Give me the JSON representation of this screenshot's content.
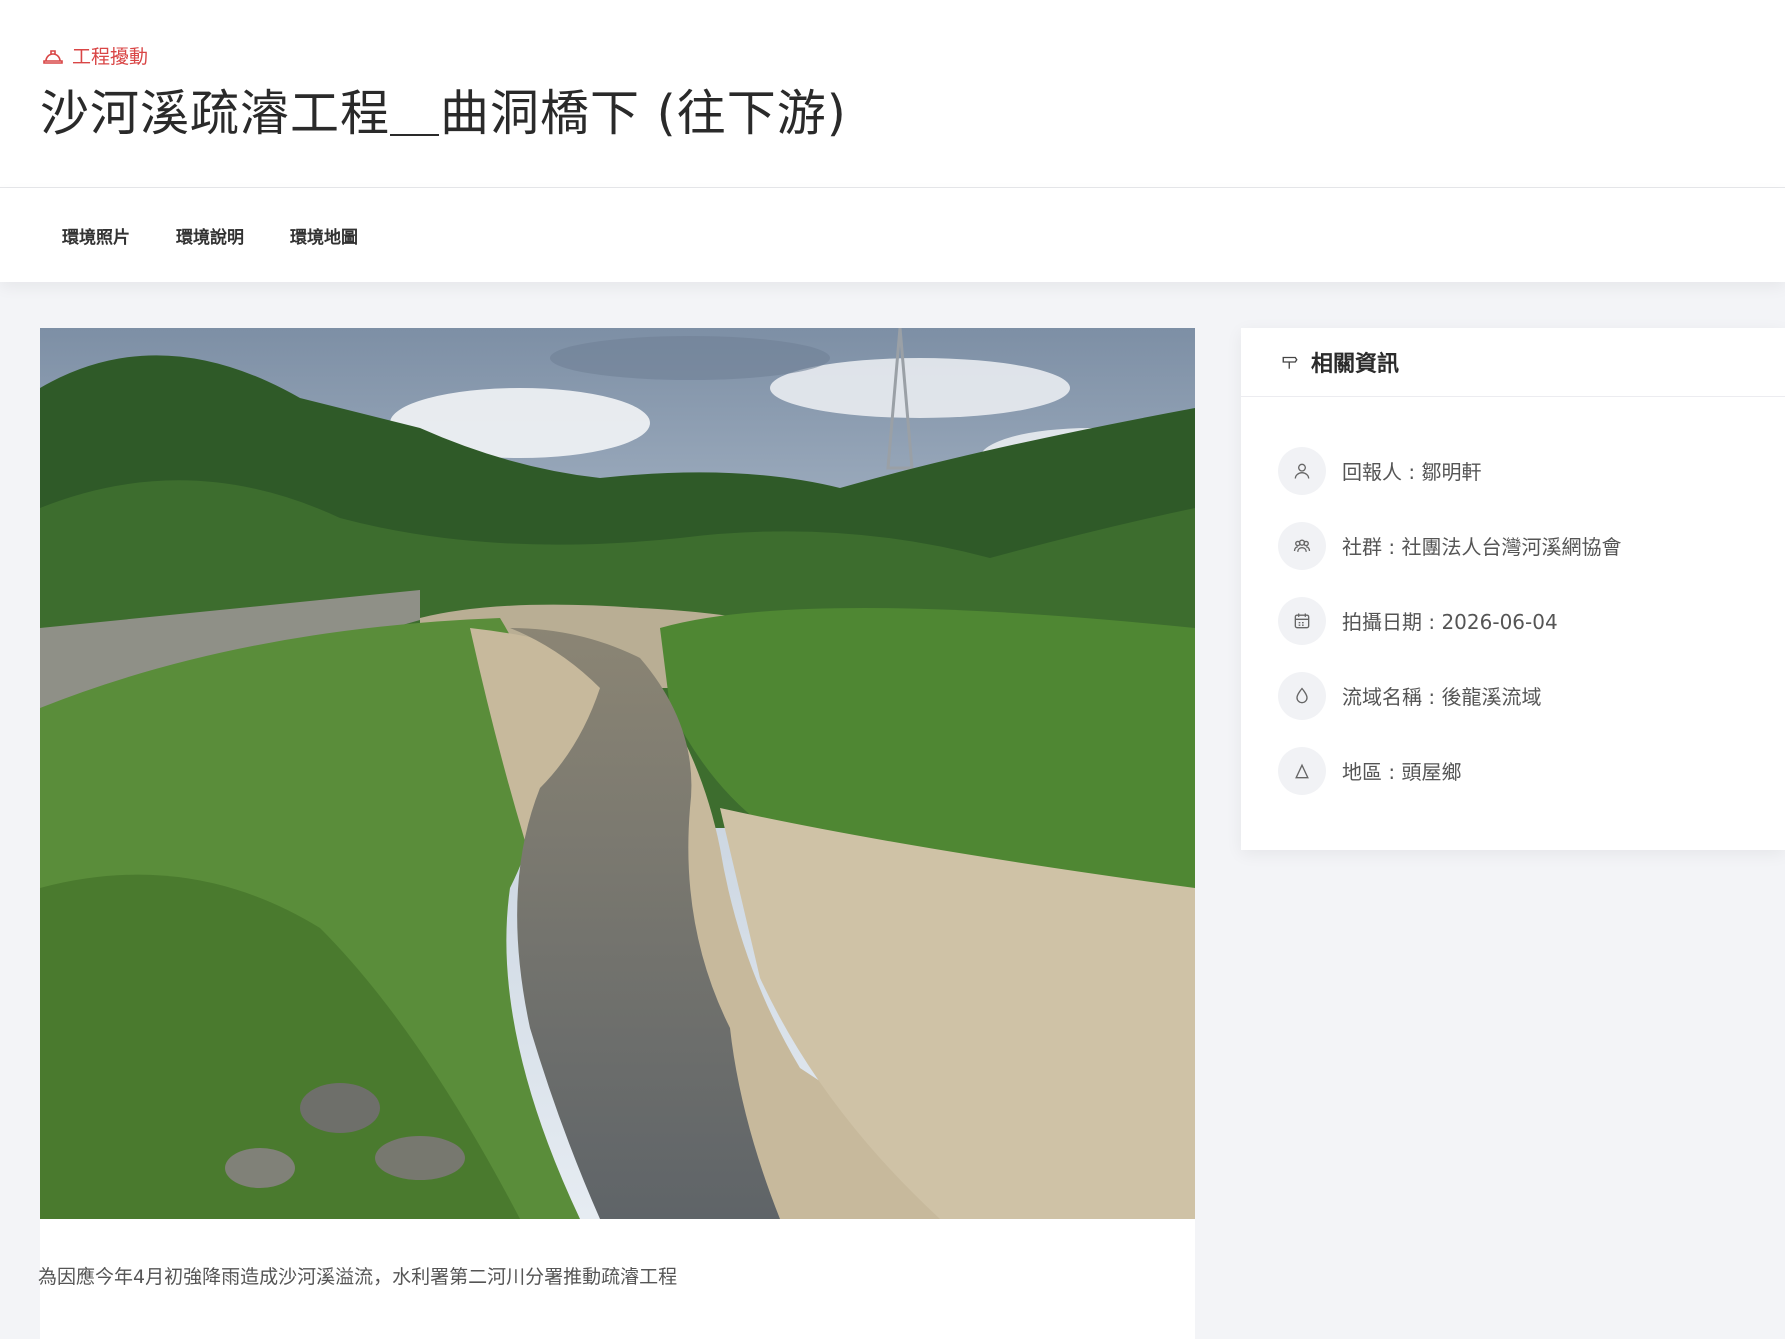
{
  "header": {
    "category": "工程擾動",
    "title": "沙河溪疏濬工程＿曲洞橋下 (往下游)"
  },
  "tabs": [
    {
      "label": "環境照片"
    },
    {
      "label": "環境說明"
    },
    {
      "label": "環境地圖"
    }
  ],
  "main": {
    "caption": "為因應今年4月初強降雨造成沙河溪溢流，水利署第二河川分署推動疏濬工程"
  },
  "side": {
    "title": "相關資訊",
    "items": [
      {
        "icon": "person-icon",
        "text": "回報人 : 鄒明軒"
      },
      {
        "icon": "group-icon",
        "text": "社群 : 社團法人台灣河溪網協會"
      },
      {
        "icon": "calendar-icon",
        "text": "拍攝日期 : 2026-06-04"
      },
      {
        "icon": "water-drop-icon",
        "text": "流域名稱 : 後龍溪流域"
      },
      {
        "icon": "mountain-icon",
        "text": "地區 : 頭屋鄉"
      }
    ]
  },
  "colors": {
    "accent": "#d94646",
    "background": "#f3f4f7"
  }
}
